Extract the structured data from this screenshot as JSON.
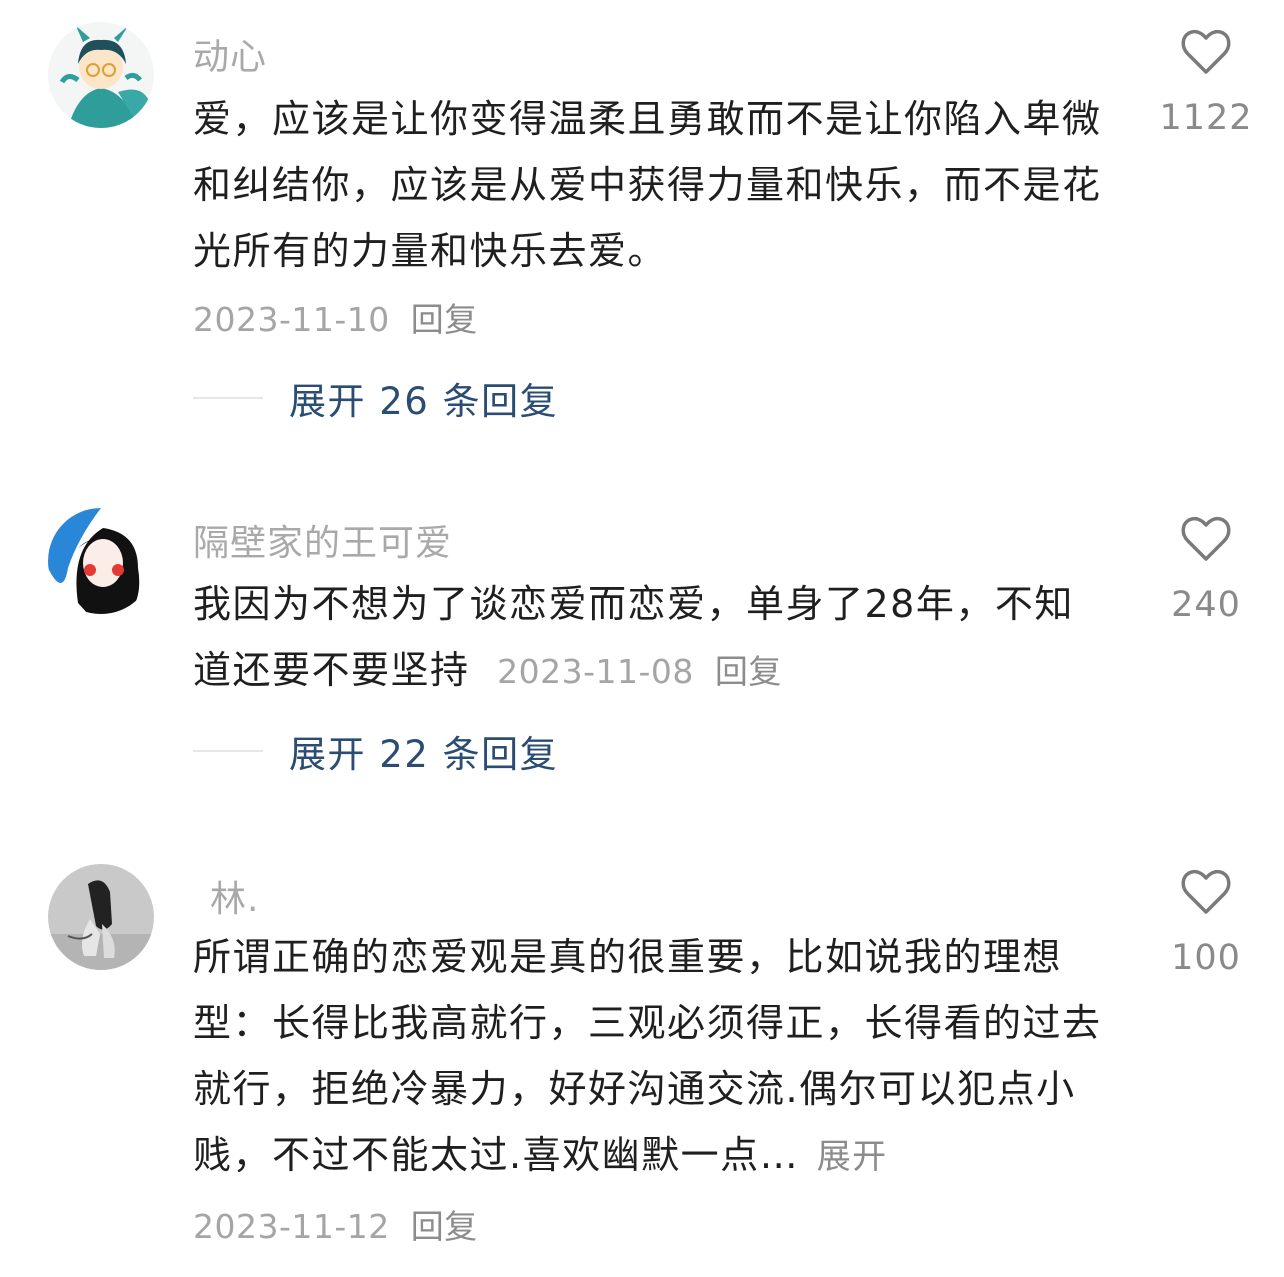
{
  "comments": [
    {
      "username": "动心",
      "text": "爱，应该是让你变得温柔且勇敢而不是让你陷入卑微和纠结你，应该是从爱中获得力量和快乐，而不是花光所有的力量和快乐去爱。",
      "date": "2023-11-10",
      "reply_label": "回复",
      "likes": "1122",
      "expand_label": "展开 26 条回复",
      "avatar_icon": "cartoon-dragon-avatar"
    },
    {
      "username": "隔壁家的王可爱",
      "text": "我因为不想为了谈恋爱而恋爱，单身了28年，不知道还要不要坚持",
      "date": "2023-11-08",
      "reply_label": "回复",
      "likes": "240",
      "expand_label": "展开 22 条回复",
      "avatar_icon": "drawn-girl-avatar"
    },
    {
      "username": "林.",
      "text": "所谓正确的恋爱观是真的很重要，比如说我的理想型：长得比我高就行，三观必须得正，长得看的过去就行，拒绝冷暴力，好好沟通交流.偶尔可以犯点小贱，不过不能太过.喜欢幽默一点…",
      "more_label": "展开",
      "date": "2023-11-12",
      "reply_label": "回复",
      "likes": "100",
      "avatar_icon": "photo-avatar"
    }
  ],
  "colors": {
    "username": "#a9a9a9",
    "text": "#1f1f1f",
    "meta": "#a5a5a5",
    "expand": "#2b4c73",
    "heart": "#7a7a7a"
  }
}
